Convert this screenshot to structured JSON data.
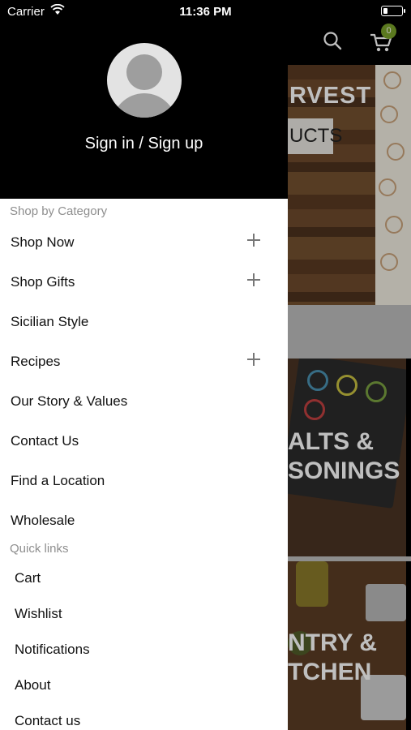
{
  "status_bar": {
    "carrier": "Carrier",
    "time": "11:36 PM",
    "battery_level": 0.25
  },
  "drawer": {
    "sign_in_label": "Sign in / Sign up",
    "shop_section_label": "Shop by Category",
    "menu_items": [
      {
        "label": "Shop Now",
        "expandable": true
      },
      {
        "label": "Shop Gifts",
        "expandable": true
      },
      {
        "label": "Sicilian Style",
        "expandable": false
      },
      {
        "label": "Recipes",
        "expandable": true
      },
      {
        "label": "Our Story & Values",
        "expandable": false
      },
      {
        "label": "Contact Us",
        "expandable": false
      },
      {
        "label": "Find a Location",
        "expandable": false
      },
      {
        "label": "Wholesale",
        "expandable": false
      }
    ],
    "quick_links_label": "Quick links",
    "quick_links": [
      {
        "label": "Cart"
      },
      {
        "label": "Wishlist"
      },
      {
        "label": "Notifications"
      },
      {
        "label": "About"
      },
      {
        "label": "Contact us"
      }
    ]
  },
  "background": {
    "cart_count": "0",
    "banner1_title": "RVEST",
    "banner1_chip": "UCTS",
    "banner2_line1": "ALTS &",
    "banner2_line2": "SONINGS",
    "banner3_line1": "NTRY &",
    "banner3_line2": "TCHEN"
  },
  "colors": {
    "drawer_header": "#000000",
    "cart_badge": "#7aa22a",
    "section_label": "#8e8e8e"
  }
}
